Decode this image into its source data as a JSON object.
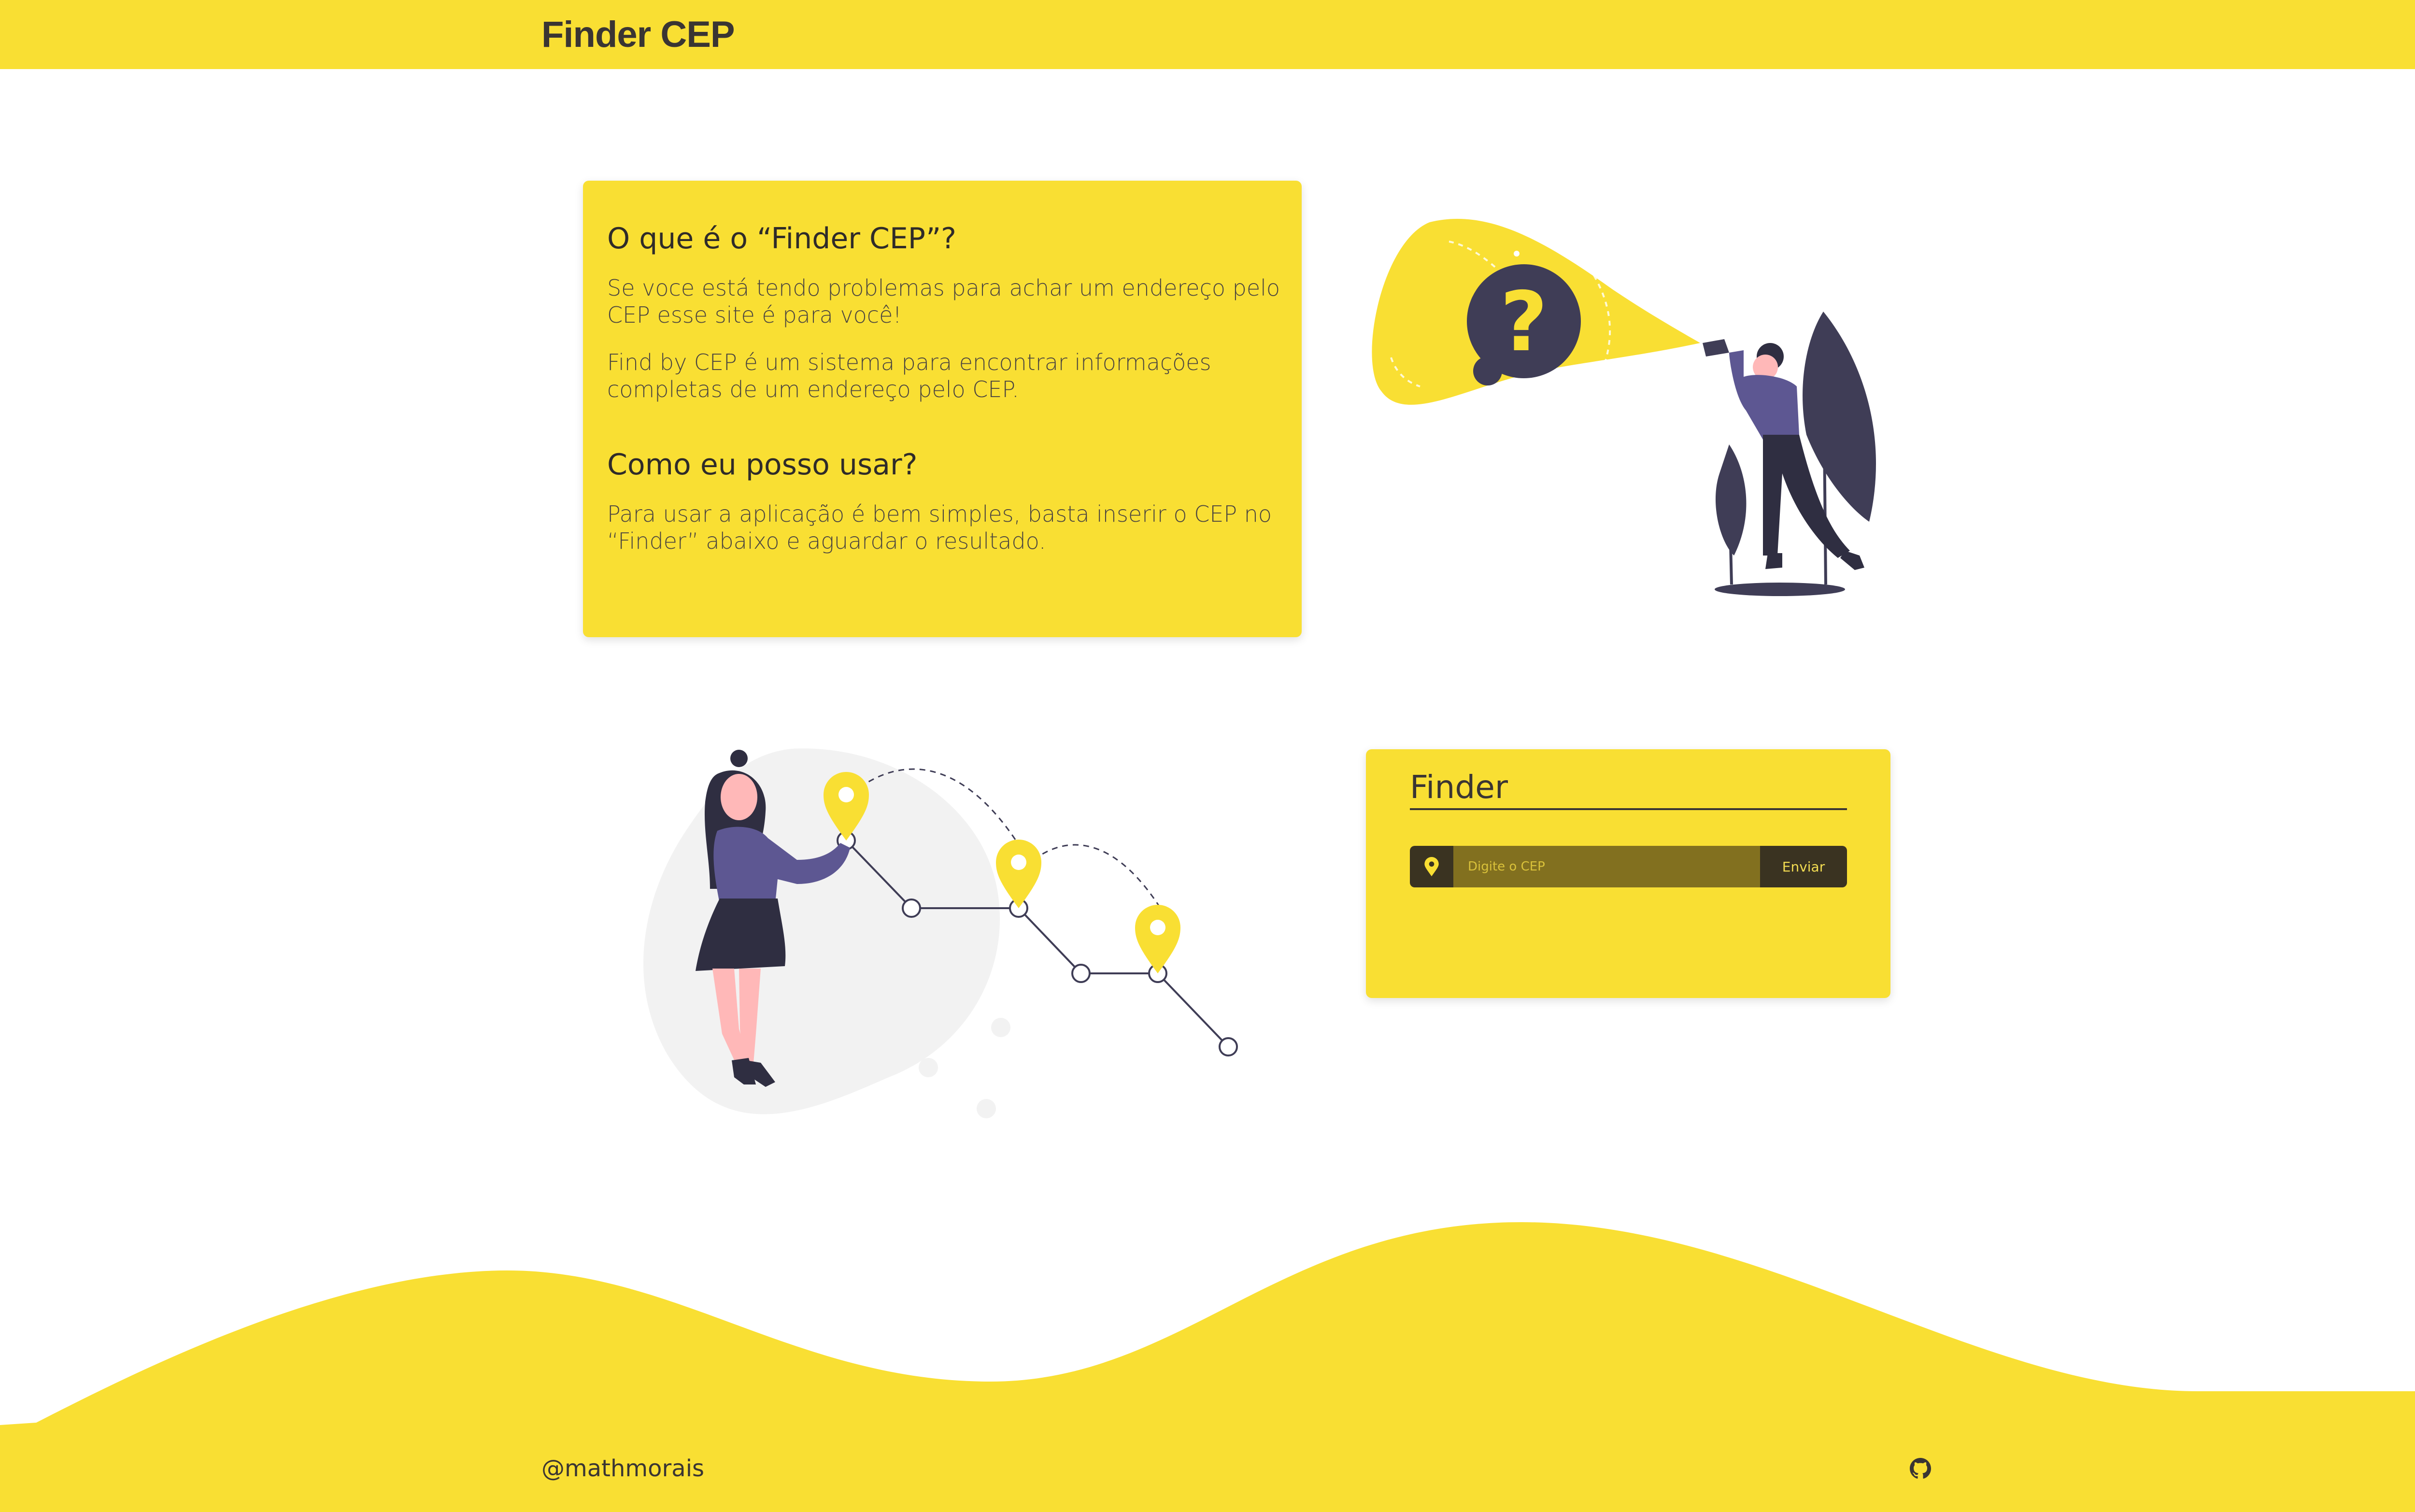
{
  "header": {
    "brand": "Finder CEP"
  },
  "info": {
    "question1": "O que é o “Finder CEP”?",
    "paragraph1": "Se voce está tendo problemas para achar um endereço pelo CEP esse site é para você!",
    "paragraph2": "Find by CEP é um sistema para encontrar informações completas de um endereço pelo CEP.",
    "question2": "Como eu posso usar?",
    "paragraph3": "Para usar a aplicação é bem simples, basta inserir o CEP no “Finder” abaixo e aguardar o resultado."
  },
  "finder": {
    "title": "Finder",
    "input_value": "",
    "input_placeholder": "Digite o CEP",
    "submit_label": "Enviar",
    "pin_icon": "map-pin-icon"
  },
  "illustrations": {
    "top": "woman-with-flashlight-question-mark",
    "bottom": "woman-with-map-route-pins"
  },
  "footer": {
    "handle": "@mathmorais",
    "github_icon": "github-icon"
  },
  "colors": {
    "accent": "#f9df33",
    "dark": "#3a3533",
    "purple": "#5d5792"
  }
}
